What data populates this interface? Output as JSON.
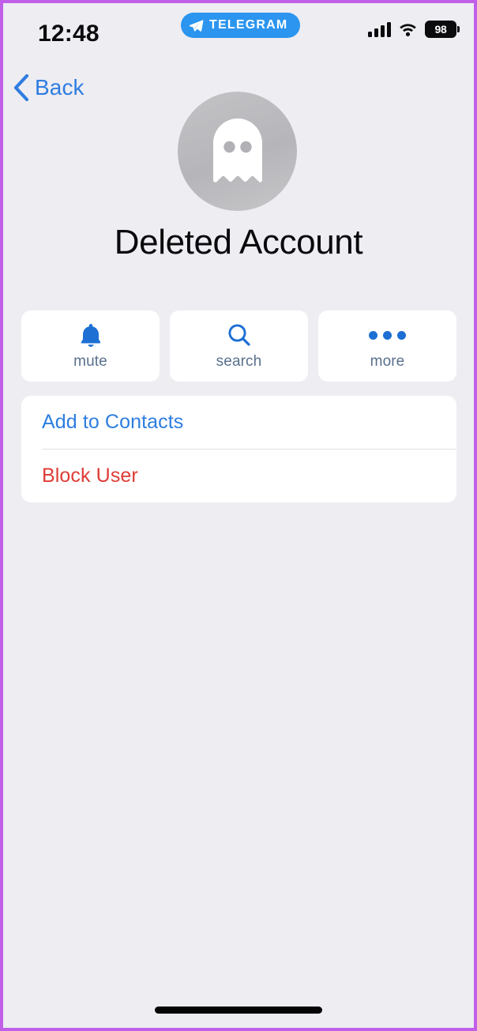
{
  "theme": {
    "frame_border_color": "#c060e8",
    "background_color": "#eeedf2",
    "card_color": "#ffffff",
    "accent_blue": "#2e7de0",
    "icon_blue": "#1d6fd4",
    "destructive_red": "#de3c36",
    "label_muted": "#59708d",
    "telegram_pill_color": "#2b95ef",
    "avatar_gray": "#bcbcc0"
  },
  "status_bar": {
    "time": "12:48",
    "app_badge": {
      "label": "TELEGRAM",
      "icon": "telegram-plane-icon"
    },
    "signal_icon": "cellular-signal-icon",
    "wifi_icon": "wifi-icon",
    "battery": {
      "icon": "battery-icon",
      "level": "98"
    }
  },
  "nav": {
    "back_label": "Back",
    "back_icon": "chevron-left-icon"
  },
  "profile": {
    "avatar_icon": "ghost-icon",
    "name": "Deleted Account"
  },
  "actions": [
    {
      "icon": "bell-icon",
      "label": "mute"
    },
    {
      "icon": "search-icon",
      "label": "search"
    },
    {
      "icon": "ellipsis-icon",
      "label": "more"
    }
  ],
  "list": [
    {
      "label": "Add to Contacts",
      "style": "primary"
    },
    {
      "label": "Block User",
      "style": "destructive"
    }
  ],
  "home_indicator": "home-indicator-bar"
}
